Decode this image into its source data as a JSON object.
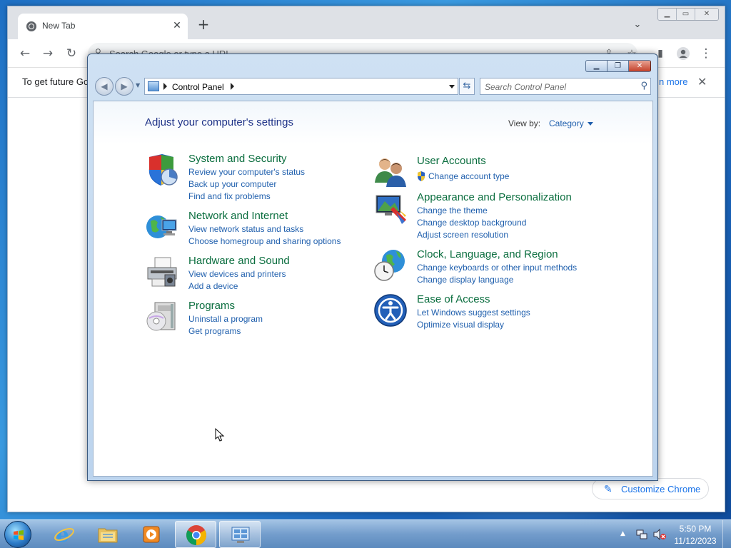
{
  "chrome": {
    "tab_title": "New Tab",
    "tab_close": "✕",
    "new_tab": "+",
    "omnibox_placeholder": "Search Google or type a URL",
    "infobar_text": "To get future Go",
    "infobar_link": "n more",
    "infobar_close": "✕",
    "customize_label": "Customize Chrome",
    "icons": [
      "back-icon",
      "forward-icon",
      "reload-icon",
      "share-icon",
      "star-icon",
      "side-panel-icon",
      "profile-icon",
      "menu-icon"
    ]
  },
  "control_panel": {
    "breadcrumb": "Control Panel",
    "search_placeholder": "Search Control Panel",
    "heading": "Adjust your computer's settings",
    "view_by_label": "View by:",
    "view_by_value": "Category",
    "categories": [
      {
        "title": "System and Security",
        "icon": "shield-icon",
        "links": [
          "Review your computer's status",
          "Back up your computer",
          "Find and fix problems"
        ]
      },
      {
        "title": "Network and Internet",
        "icon": "network-globe-icon",
        "links": [
          "View network status and tasks",
          "Choose homegroup and sharing options"
        ]
      },
      {
        "title": "Hardware and Sound",
        "icon": "printer-icon",
        "links": [
          "View devices and printers",
          "Add a device"
        ]
      },
      {
        "title": "Programs",
        "icon": "programs-disc-icon",
        "links": [
          "Uninstall a program",
          "Get programs"
        ]
      },
      {
        "title": "User Accounts",
        "icon": "users-icon",
        "links": [
          "Change account type"
        ]
      },
      {
        "title": "Appearance and Personalization",
        "icon": "monitor-paint-icon",
        "links": [
          "Change the theme",
          "Change desktop background",
          "Adjust screen resolution"
        ]
      },
      {
        "title": "Clock, Language, and Region",
        "icon": "clock-globe-icon",
        "links": [
          "Change keyboards or other input methods",
          "Change display language"
        ]
      },
      {
        "title": "Ease of Access",
        "icon": "ease-of-access-icon",
        "links": [
          "Let Windows suggest settings",
          "Optimize visual display"
        ]
      }
    ]
  },
  "taskbar": {
    "time": "5:50 PM",
    "date": "11/12/2023",
    "apps": [
      "internet-explorer",
      "file-explorer",
      "media-player",
      "chrome",
      "control-panel"
    ]
  }
}
